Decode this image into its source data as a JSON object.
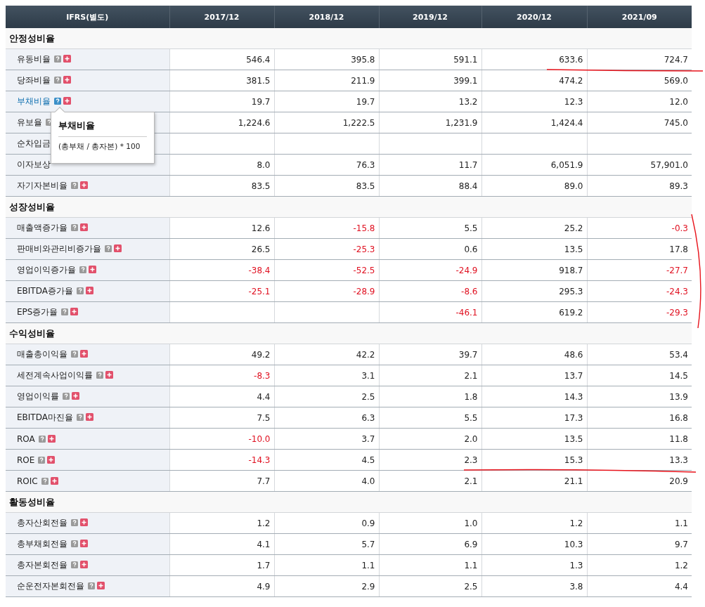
{
  "table": {
    "header": {
      "label_column": "IFRS(별도)",
      "periods": [
        "2017/12",
        "2018/12",
        "2019/12",
        "2020/12",
        "2021/09"
      ]
    },
    "sections": [
      {
        "title": "안정성비율",
        "rows": [
          {
            "label": "유동비율",
            "active": false,
            "icons": true,
            "values": {
              "column_1": "546.4",
              "column_2": "395.8",
              "column_3": "591.1",
              "column_4": "633.6",
              "column_5": "724.7"
            }
          },
          {
            "label": "당좌비율",
            "active": false,
            "icons": true,
            "values": {
              "column_1": "381.5",
              "column_2": "211.9",
              "column_3": "399.1",
              "column_4": "474.2",
              "column_5": "569.0"
            }
          },
          {
            "label": "부채비율",
            "active": true,
            "icons": true,
            "values": {
              "column_1": "19.7",
              "column_2": "19.7",
              "column_3": "13.2",
              "column_4": "12.3",
              "column_5": "12.0"
            },
            "tooltip": {
              "title": "부채비율",
              "formula": "(총부채 / 총자본) * 100"
            }
          },
          {
            "label": "유보율",
            "active": false,
            "icons": true,
            "expand_hidden": true,
            "values": {
              "column_1": "1,224.6",
              "column_2": "1,222.5",
              "column_3": "1,231.9",
              "column_4": "1,424.4",
              "column_5": "745.0"
            }
          },
          {
            "label": "순차입금",
            "active": false,
            "icons": false
          },
          {
            "label": "이자보상",
            "active": false,
            "icons": false,
            "values": {
              "column_1": "8.0",
              "column_2": "76.3",
              "column_3": "11.7",
              "column_4": "6,051.9",
              "column_5": "57,901.0"
            }
          },
          {
            "label": "자기자본비율",
            "active": false,
            "icons": true,
            "values": {
              "column_1": "83.5",
              "column_2": "83.5",
              "column_3": "88.4",
              "column_4": "89.0",
              "column_5": "89.3"
            }
          }
        ]
      },
      {
        "title": "성장성비율",
        "rows": [
          {
            "label": "매출액증가율",
            "active": false,
            "icons": true,
            "values": {
              "column_1": "12.6",
              "column_2": "-15.8",
              "column_3": "5.5",
              "column_4": "25.2",
              "column_5": "-0.3"
            }
          },
          {
            "label": "판매비와관리비증가율",
            "active": false,
            "icons": true,
            "values": {
              "column_1": "26.5",
              "column_2": "-25.3",
              "column_3": "0.6",
              "column_4": "13.5",
              "column_5": "17.8"
            }
          },
          {
            "label": "영업이익증가율",
            "active": false,
            "icons": true,
            "values": {
              "column_1": "-38.4",
              "column_2": "-52.5",
              "column_3": "-24.9",
              "column_4": "918.7",
              "column_5": "-27.7"
            }
          },
          {
            "label": "EBITDA증가율",
            "active": false,
            "icons": true,
            "values": {
              "column_1": "-25.1",
              "column_2": "-28.9",
              "column_3": "-8.6",
              "column_4": "295.3",
              "column_5": "-24.3"
            }
          },
          {
            "label": "EPS증가율",
            "active": false,
            "icons": true,
            "values": {
              "column_3": "-46.1",
              "column_4": "619.2",
              "column_5": "-29.3"
            }
          }
        ]
      },
      {
        "title": "수익성비율",
        "rows": [
          {
            "label": "매출총이익율",
            "active": false,
            "icons": true,
            "values": {
              "column_1": "49.2",
              "column_2": "42.2",
              "column_3": "39.7",
              "column_4": "48.6",
              "column_5": "53.4"
            }
          },
          {
            "label": "세전계속사업이익률",
            "active": false,
            "icons": true,
            "values": {
              "column_1": "-8.3",
              "column_2": "3.1",
              "column_3": "2.1",
              "column_4": "13.7",
              "column_5": "14.5"
            }
          },
          {
            "label": "영업이익률",
            "active": false,
            "icons": true,
            "values": {
              "column_1": "4.4",
              "column_2": "2.5",
              "column_3": "1.8",
              "column_4": "14.3",
              "column_5": "13.9"
            }
          },
          {
            "label": "EBITDA마진율",
            "active": false,
            "icons": true,
            "values": {
              "column_1": "7.5",
              "column_2": "6.3",
              "column_3": "5.5",
              "column_4": "17.3",
              "column_5": "16.8"
            }
          },
          {
            "label": "ROA",
            "active": false,
            "icons": true,
            "values": {
              "column_1": "-10.0",
              "column_2": "3.7",
              "column_3": "2.0",
              "column_4": "13.5",
              "column_5": "11.8"
            }
          },
          {
            "label": "ROE",
            "active": false,
            "icons": true,
            "values": {
              "column_1": "-14.3",
              "column_2": "4.5",
              "column_3": "2.3",
              "column_4": "15.3",
              "column_5": "13.3"
            }
          },
          {
            "label": "ROIC",
            "active": false,
            "icons": true,
            "values": {
              "column_1": "7.7",
              "column_2": "4.0",
              "column_3": "2.1",
              "column_4": "21.1",
              "column_5": "20.9"
            }
          }
        ]
      },
      {
        "title": "활동성비율",
        "rows": [
          {
            "label": "총자산회전율",
            "active": false,
            "icons": true,
            "values": {
              "column_1": "1.2",
              "column_2": "0.9",
              "column_3": "1.0",
              "column_4": "1.2",
              "column_5": "1.1"
            }
          },
          {
            "label": "총부채회전율",
            "active": false,
            "icons": true,
            "values": {
              "column_1": "4.1",
              "column_2": "5.7",
              "column_3": "6.9",
              "column_4": "10.3",
              "column_5": "9.7"
            }
          },
          {
            "label": "총자본회전율",
            "active": false,
            "icons": true,
            "values": {
              "column_1": "1.7",
              "column_2": "1.1",
              "column_3": "1.1",
              "column_4": "1.3",
              "column_5": "1.2"
            }
          },
          {
            "label": "순운전자본회전율",
            "active": false,
            "icons": true,
            "values": {
              "column_1": "4.9",
              "column_2": "2.9",
              "column_3": "2.5",
              "column_4": "3.8",
              "column_5": "4.4"
            }
          }
        ]
      }
    ]
  },
  "pen_marks": [
    {
      "kind": "underline"
    },
    {
      "kind": "bracket"
    },
    {
      "kind": "underline"
    }
  ]
}
